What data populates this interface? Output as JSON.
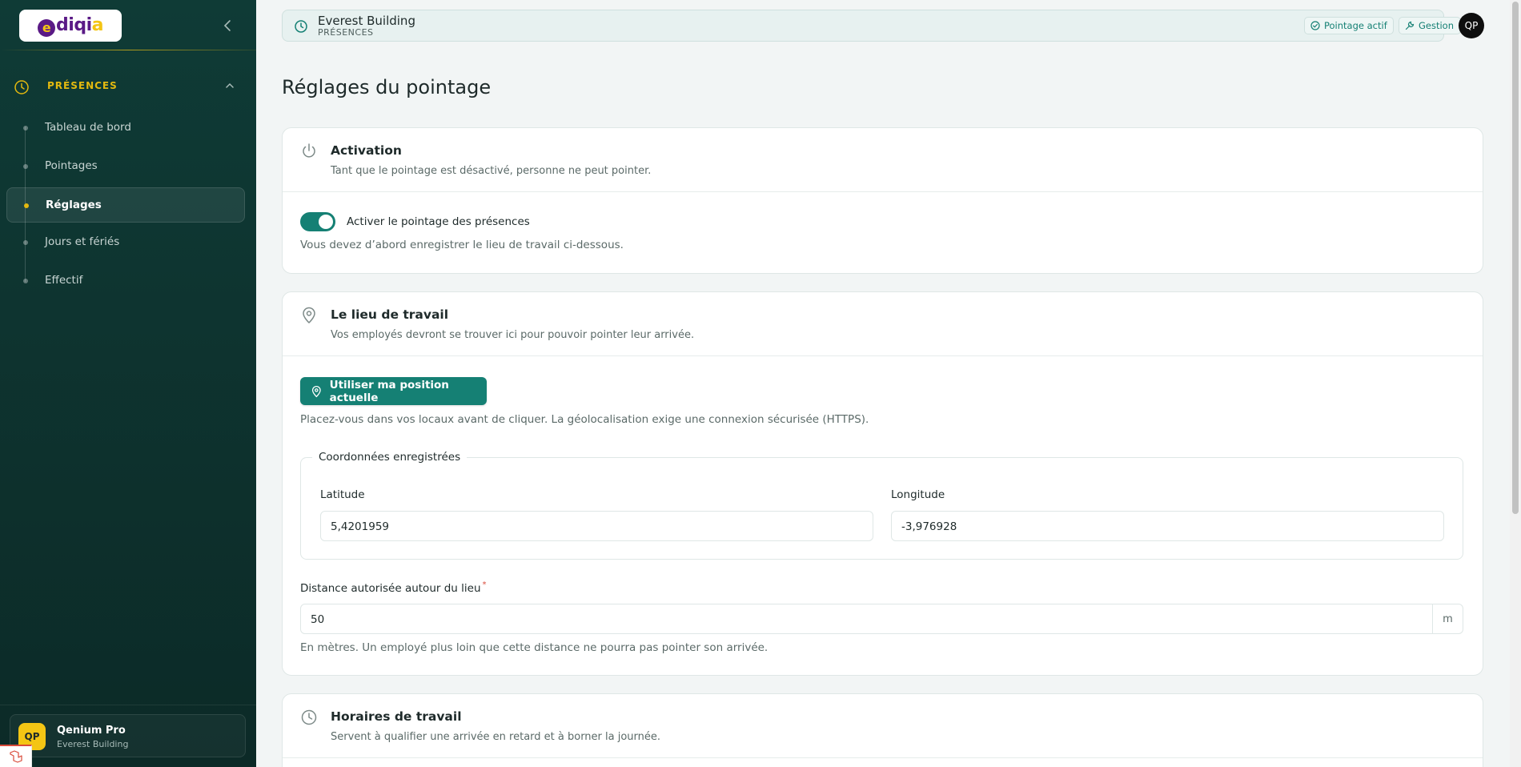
{
  "sidebar": {
    "logo": "ediqia",
    "section_label": "PRÉSENCES",
    "items": [
      {
        "label": "Tableau de bord"
      },
      {
        "label": "Pointages"
      },
      {
        "label": "Réglages"
      },
      {
        "label": "Jours et fériés"
      },
      {
        "label": "Effectif"
      }
    ],
    "active_item": "Réglages",
    "user": {
      "initials": "QP",
      "name": "Qenium Pro",
      "org": "Everest Building"
    }
  },
  "header": {
    "title": "Everest Building",
    "subtitle": "PRÉSENCES",
    "status_pill": "Pointage actif",
    "manage_pill": "Gestion",
    "avatar_initials": "QP"
  },
  "page": {
    "title": "Réglages du pointage"
  },
  "activation": {
    "title": "Activation",
    "description": "Tant que le pointage est désactivé, personne ne peut pointer.",
    "toggle_label": "Activer le pointage des présences",
    "toggle_on": true,
    "help": "Vous devez d’abord enregistrer le lieu de travail ci-dessous."
  },
  "location": {
    "title": "Le lieu de travail",
    "description": "Vos employés devront se trouver ici pour pouvoir pointer leur arrivée.",
    "geo_button": "Utiliser ma position actuelle",
    "geo_help": "Placez-vous dans vos locaux avant de cliquer. La géolocalisation exige une connexion sécurisée (HTTPS).",
    "coords_legend": "Coordonnées enregistrées",
    "latitude_label": "Latitude",
    "latitude_value": "5,4201959",
    "longitude_label": "Longitude",
    "longitude_value": "-3,976928",
    "distance_label": "Distance autorisée autour du lieu",
    "distance_required_mark": "*",
    "distance_value": "50",
    "distance_unit": "m",
    "distance_help": "En mètres. Un employé plus loin que cette distance ne pourra pas pointer son arrivée."
  },
  "hours": {
    "title": "Horaires de travail",
    "description": "Servent à qualifier une arrivée en retard et à borner la journée."
  },
  "colors": {
    "sidebar_bg": "#0f3b36",
    "accent": "#158074",
    "section_gold": "#e3b90f",
    "logo_purple": "#5a1a86"
  }
}
